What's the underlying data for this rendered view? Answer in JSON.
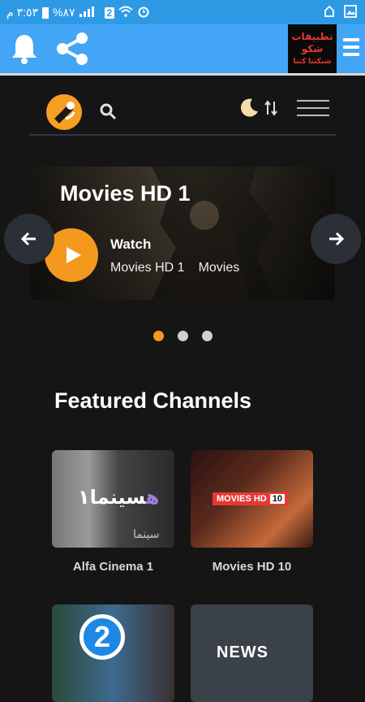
{
  "status_bar": {
    "time": "٣:٥٣ م",
    "battery": "%٨٧",
    "sim_badge": "2"
  },
  "app_bar": {
    "logo_text_line1": "تطبيقات",
    "logo_text_line2": "شكو",
    "logo_text_line3": "شبكتنا كتنا"
  },
  "hero": {
    "title": "Movies HD 1",
    "watch_label": "Watch",
    "channel": "Movies HD 1",
    "category": "Movies"
  },
  "section": {
    "title": "Featured Channels"
  },
  "channels": [
    {
      "label": "Alfa Cinema 1",
      "art_text": "سينما١",
      "art_text_accent": "ه",
      "art_text_secondary": "سينما"
    },
    {
      "label": "Movies HD 10",
      "art_text": "MOVIES HD",
      "art_number": "10"
    },
    {
      "label": "",
      "art_text": "2"
    },
    {
      "label": "",
      "art_text": "NEWS"
    }
  ],
  "colors": {
    "status_bar": "#2e9ae6",
    "app_bar": "#42a5f5",
    "accent": "#f39a1e",
    "background": "#151515"
  }
}
